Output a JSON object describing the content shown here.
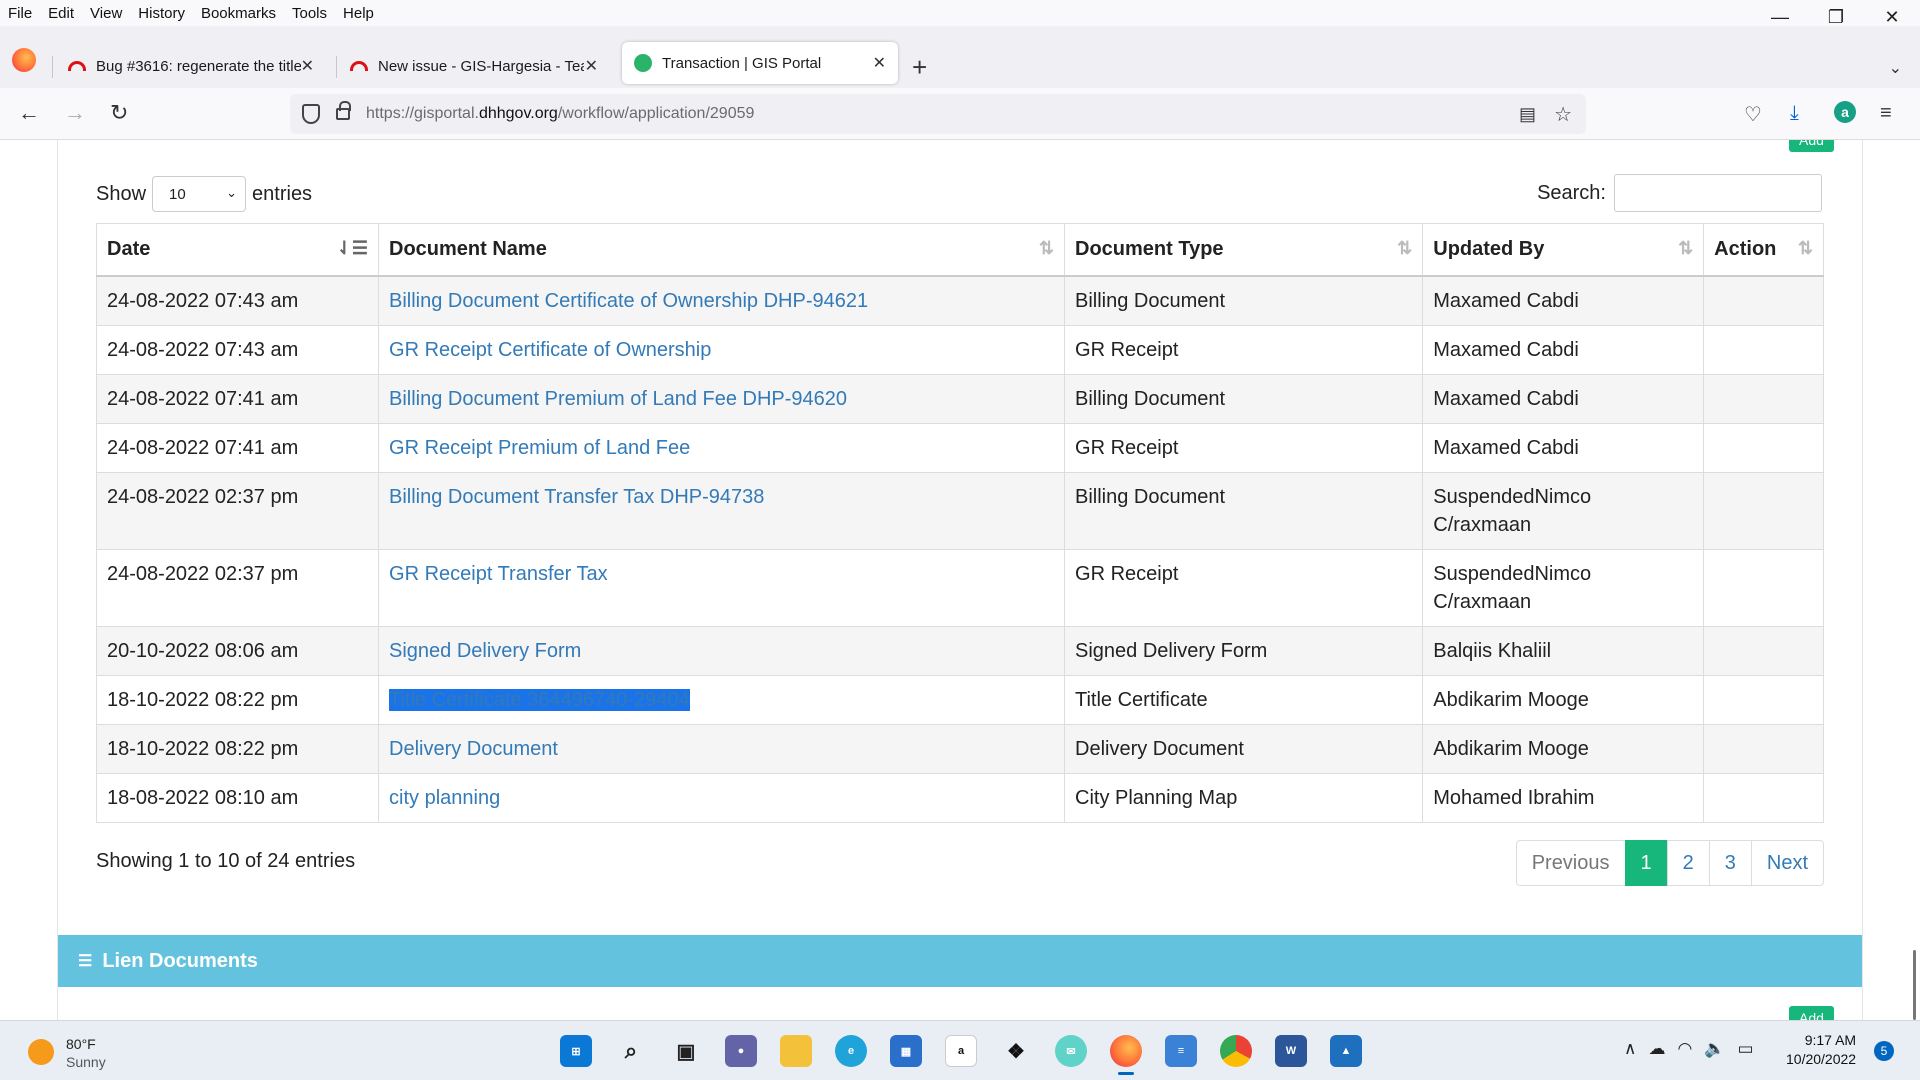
{
  "menu": [
    "File",
    "Edit",
    "View",
    "History",
    "Bookmarks",
    "Tools",
    "Help"
  ],
  "window_controls": {
    "minimize": "—",
    "restore": "❐",
    "close": "✕"
  },
  "tabs": [
    {
      "title": "Bug #3616: regenerate the title",
      "icon": "redhat-icon"
    },
    {
      "title": "New issue - GIS-Hargesia - Tear",
      "icon": "redhat-icon"
    },
    {
      "title": "Transaction | GIS Portal",
      "icon": "gis-portal-icon",
      "active": true
    }
  ],
  "url": {
    "prefix": "https://gisportal.",
    "domain": "dhhgov.org",
    "path": "/workflow/application/29059"
  },
  "table_controls": {
    "show_label": "Show",
    "entries_value": "10",
    "entries_label": "entries",
    "search_label": "Search:"
  },
  "add_label": "Add",
  "columns": [
    "Date",
    "Document Name",
    "Document Type",
    "Updated By",
    "Action"
  ],
  "rows": [
    {
      "date": "24-08-2022 07:43 am",
      "name": "Billing Document Certificate of Ownership DHP-94621",
      "type": "Billing Document",
      "updated_by": "Maxamed Cabdi"
    },
    {
      "date": "24-08-2022 07:43 am",
      "name": "GR Receipt Certificate of Ownership",
      "type": "GR Receipt",
      "updated_by": "Maxamed Cabdi"
    },
    {
      "date": "24-08-2022 07:41 am",
      "name": "Billing Document Premium of Land Fee DHP-94620",
      "type": "Billing Document",
      "updated_by": "Maxamed Cabdi"
    },
    {
      "date": "24-08-2022 07:41 am",
      "name": "GR Receipt Premium of Land Fee",
      "type": "GR Receipt",
      "updated_by": "Maxamed Cabdi"
    },
    {
      "date": "24-08-2022 02:37 pm",
      "name": "Billing Document Transfer Tax DHP-94738",
      "type": "Billing Document",
      "updated_by": "SuspendedNimco C/raxmaan"
    },
    {
      "date": "24-08-2022 02:37 pm",
      "name": "GR Receipt Transfer Tax",
      "type": "GR Receipt",
      "updated_by": "SuspendedNimco C/raxmaan"
    },
    {
      "date": "20-10-2022 08:06 am",
      "name": "Signed Delivery Form",
      "type": "Signed Delivery Form",
      "updated_by": "Balqiis Khaliil"
    },
    {
      "date": "18-10-2022 08:22 pm",
      "name": "Title Certificate 364496740-29404",
      "type": "Title Certificate",
      "updated_by": "Abdikarim Mooge",
      "selected": true
    },
    {
      "date": "18-10-2022 08:22 pm",
      "name": "Delivery Document",
      "type": "Delivery Document",
      "updated_by": "Abdikarim Mooge"
    },
    {
      "date": "18-08-2022 08:10 am",
      "name": "city planning",
      "type": "City Planning Map",
      "updated_by": "Mohamed Ibrahim"
    }
  ],
  "info": "Showing 1 to 10 of 24 entries",
  "pagination": {
    "previous": "Previous",
    "pages": [
      "1",
      "2",
      "3"
    ],
    "current": "1",
    "next": "Next"
  },
  "lien_section": {
    "title": "Lien Documents",
    "icon": "list-icon"
  },
  "taskbar": {
    "weather": {
      "temp": "80°F",
      "condition": "Sunny"
    },
    "time": "9:17 AM",
    "date": "10/20/2022",
    "notifications": "5",
    "apps": [
      "windows-start-icon",
      "search-icon",
      "task-view-icon",
      "teams-chat-icon",
      "file-explorer-icon",
      "edge-icon",
      "microsoft-store-icon",
      "amazon-icon",
      "dropbox-icon",
      "mail-icon",
      "firefox-icon",
      "notepad-icon",
      "chrome-icon",
      "word-icon",
      "photos-icon"
    ]
  },
  "colors": {
    "accent_green": "#17b77b",
    "link_blue": "#337ab7",
    "lien_header": "#63c3de",
    "selection": "#1a73e8"
  }
}
